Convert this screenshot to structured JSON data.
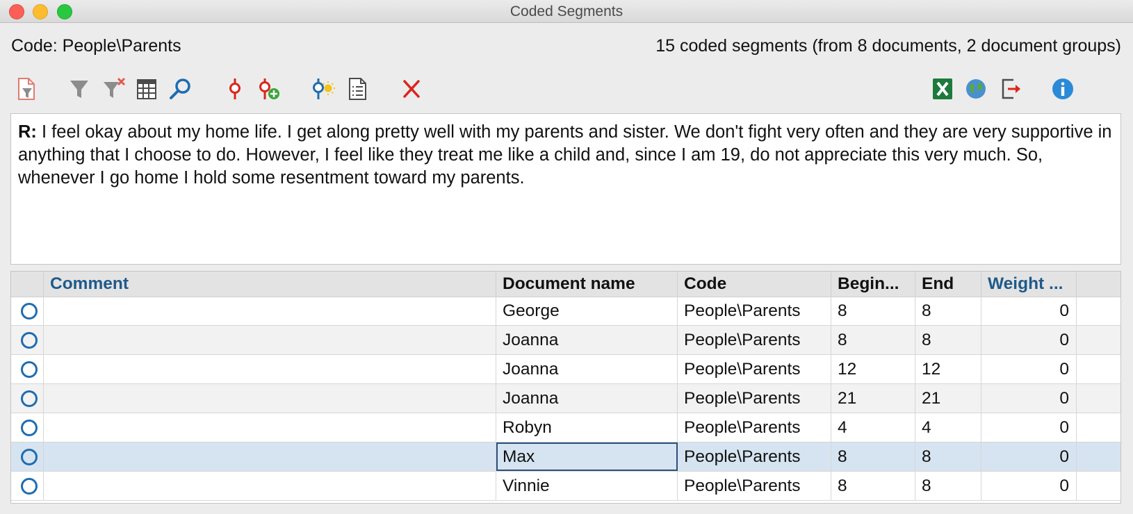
{
  "window": {
    "title": "Coded Segments"
  },
  "info": {
    "code_label": "Code: People\\Parents",
    "segment_count": "15 coded segments (from 8 documents, 2 document groups)"
  },
  "toolbar": {
    "left_icons": [
      "filter-document-icon",
      "filter-icon",
      "clear-filter-icon",
      "table-view-icon",
      "search-icon",
      "code-pin-icon",
      "code-pin-add-icon",
      "code-highlight-icon",
      "document-list-icon",
      "delete-icon"
    ],
    "right_icons": [
      "excel-export-icon",
      "web-export-icon",
      "export-arrow-icon",
      "info-icon"
    ]
  },
  "preview": {
    "speaker": "R:",
    "text": " I feel okay about my home life. I get along pretty well with my parents and sister. We don't fight very often and they are very supportive in anything that I choose to do. However, I feel like they treat me like a child and, since I am 19, do not appreciate this very much. So, whenever I go home I hold some resentment toward my parents."
  },
  "table": {
    "columns": [
      "",
      "Comment",
      "Document name",
      "Code",
      "Begin...",
      "End",
      "Weight ..."
    ],
    "rows": [
      {
        "comment": "",
        "document": "George",
        "code": "People\\Parents",
        "begin": "8",
        "end": "8",
        "weight": "0"
      },
      {
        "comment": "",
        "document": "Joanna",
        "code": "People\\Parents",
        "begin": "8",
        "end": "8",
        "weight": "0"
      },
      {
        "comment": "",
        "document": "Joanna",
        "code": "People\\Parents",
        "begin": "12",
        "end": "12",
        "weight": "0"
      },
      {
        "comment": "",
        "document": "Joanna",
        "code": "People\\Parents",
        "begin": "21",
        "end": "21",
        "weight": "0"
      },
      {
        "comment": "",
        "document": "Robyn",
        "code": "People\\Parents",
        "begin": "4",
        "end": "4",
        "weight": "0"
      },
      {
        "comment": "",
        "document": "Max",
        "code": "People\\Parents",
        "begin": "8",
        "end": "8",
        "weight": "0"
      },
      {
        "comment": "",
        "document": "Vinnie",
        "code": "People\\Parents",
        "begin": "8",
        "end": "8",
        "weight": "0"
      }
    ],
    "selected_row": 5
  },
  "colors": {
    "accent_blue": "#1e6cb0",
    "header_blue": "#1f5a8a",
    "delete_red": "#d9261c",
    "selection": "#d6e4f1"
  }
}
